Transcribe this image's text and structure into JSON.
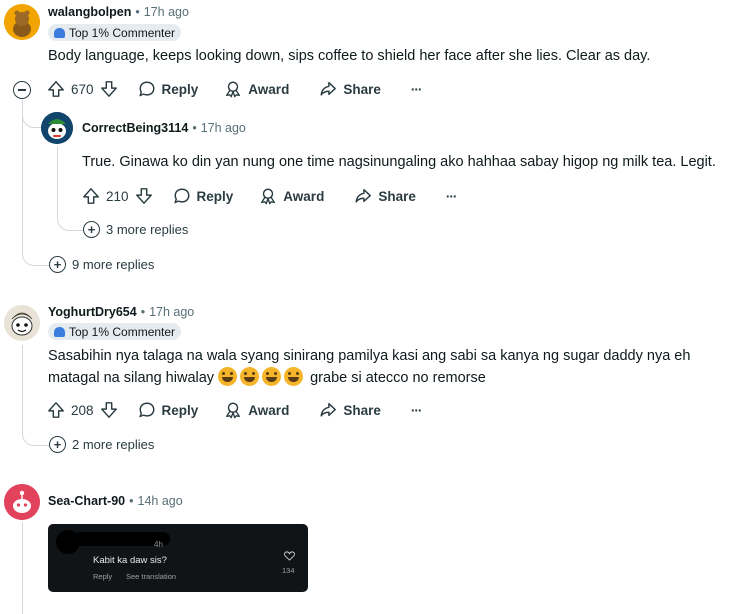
{
  "comments": [
    {
      "username": "walangbolpen",
      "time": "17h ago",
      "badge": "Top 1% Commenter",
      "text": "Body language, keeps looking down, sips coffee to shield her face after she lies. Clear as day.",
      "votes": "670",
      "more_replies": "9 more replies",
      "reply": {
        "username": "CorrectBeing3114",
        "time": "17h ago",
        "text": "True. Ginawa ko din yan nung one time nagsinungaling ako hahhaa sabay higop ng milk tea. Legit.",
        "votes": "210",
        "more_replies": "3 more replies"
      }
    },
    {
      "username": "YoghurtDry654",
      "time": "17h ago",
      "badge": "Top 1% Commenter",
      "text_line1": "Sasabihin nya talaga na wala syang sinirang pamilya kasi ang sabi sa kanya ng sugar daddy nya eh",
      "text_line2_prefix": "matagal na silang hiwalay",
      "text_line2_suffix": "grabe si atecco no remorse",
      "votes": "208",
      "more_replies": "2 more replies"
    },
    {
      "username": "Sea-Chart-90",
      "time": "14h ago",
      "embed": {
        "time": "4h",
        "text": "Kabit ka daw sis?",
        "reply": "Reply",
        "translate": "See translation",
        "likes": "134"
      }
    }
  ],
  "labels": {
    "reply": "Reply",
    "award": "Award",
    "share": "Share",
    "overflow": "···",
    "dot": "•"
  },
  "icons": {
    "upvote": "arrow-up-icon",
    "downvote": "arrow-down-icon",
    "reply": "speech-bubble-icon",
    "award": "award-icon",
    "share": "share-arrow-icon",
    "collapse": "minus-circle-icon",
    "expand": "plus-circle-icon",
    "heart": "heart-icon"
  },
  "colors": {
    "badge_bg": "#e5ebee",
    "badge_icon": "#3b7ddd",
    "thread_line": "#d3dadd",
    "meta_text": "#576f76"
  }
}
